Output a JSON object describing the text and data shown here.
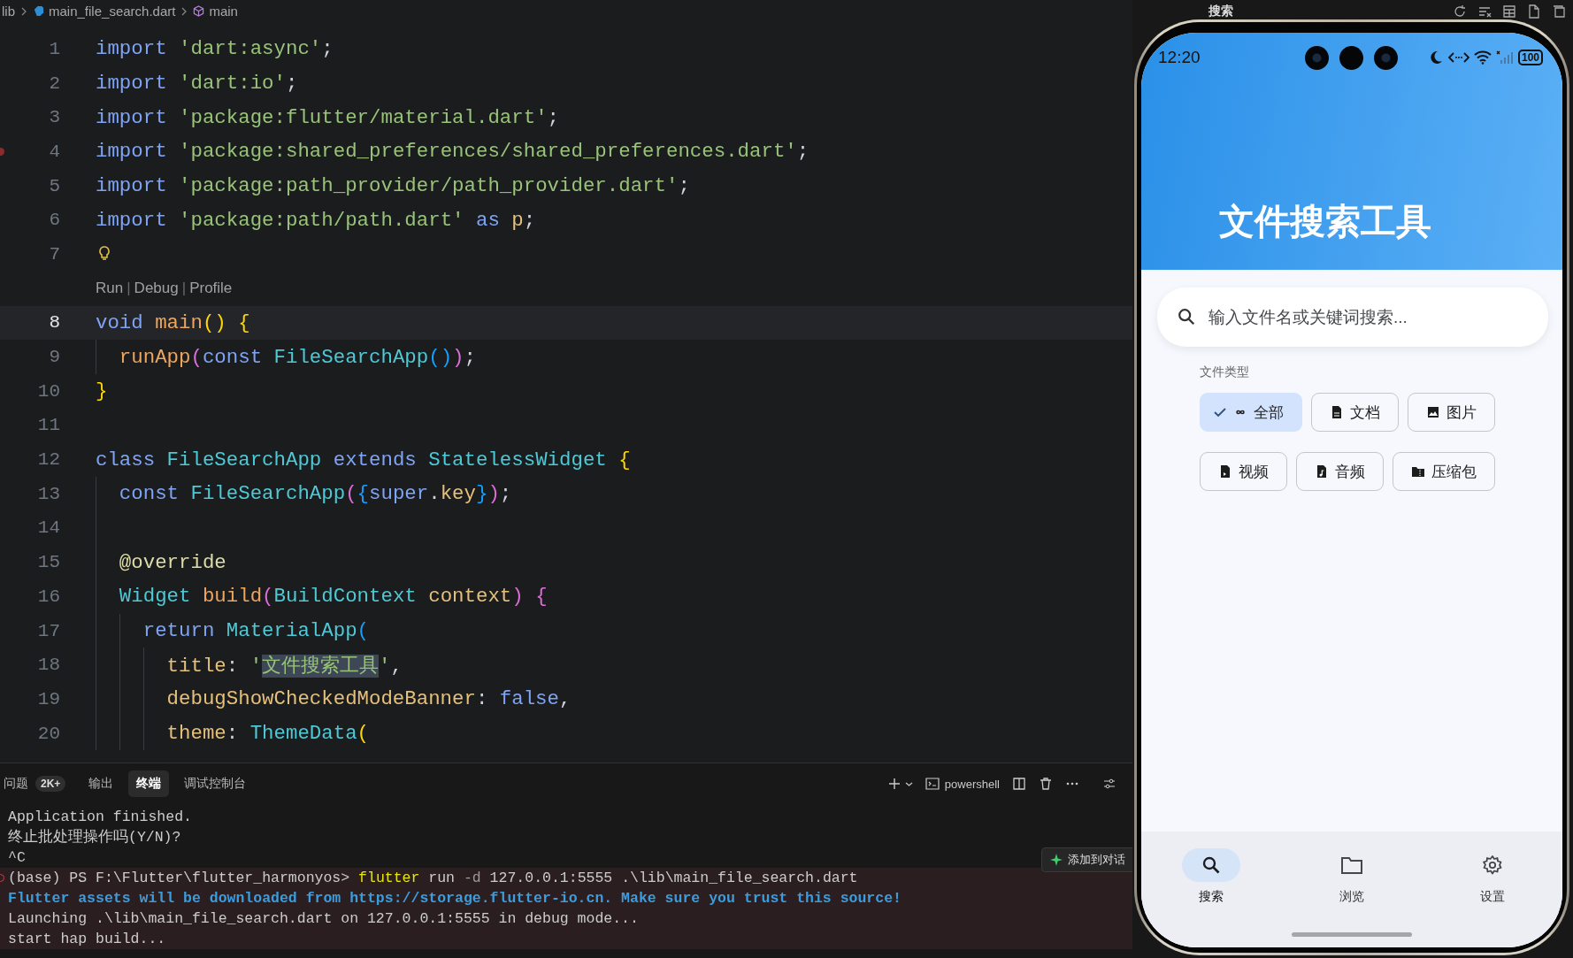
{
  "editor": {
    "breadcrumb": [
      {
        "kind": "folder",
        "text": "lib"
      },
      {
        "kind": "file",
        "text": "main_file_search.dart"
      },
      {
        "kind": "symbol",
        "text": "main"
      }
    ],
    "lines": [
      {
        "kind": "code",
        "number": "1",
        "current": false,
        "breakpoint": false,
        "lightbulb": false,
        "tokens": [
          {
            "kind": "kw",
            "text": "import"
          },
          {
            "kind": "str",
            "text": " 'dart:async'"
          },
          {
            "kind": "punct",
            "text": ";"
          }
        ]
      },
      {
        "kind": "code",
        "number": "2",
        "current": false,
        "breakpoint": false,
        "lightbulb": false,
        "tokens": [
          {
            "kind": "kw",
            "text": "import"
          },
          {
            "kind": "str",
            "text": " 'dart:io'"
          },
          {
            "kind": "punct",
            "text": ";"
          }
        ]
      },
      {
        "kind": "code",
        "number": "3",
        "current": false,
        "breakpoint": false,
        "lightbulb": false,
        "tokens": [
          {
            "kind": "kw",
            "text": "import"
          },
          {
            "kind": "str",
            "text": " 'package:flutter/material.dart'"
          },
          {
            "kind": "punct",
            "text": ";"
          }
        ]
      },
      {
        "kind": "code",
        "number": "4",
        "current": false,
        "breakpoint": true,
        "lightbulb": false,
        "tokens": [
          {
            "kind": "kw",
            "text": "import"
          },
          {
            "kind": "str",
            "text": " 'package:shared_preferences/shared_preferences.dart'"
          },
          {
            "kind": "punct",
            "text": ";"
          }
        ]
      },
      {
        "kind": "code",
        "number": "5",
        "current": false,
        "breakpoint": false,
        "lightbulb": false,
        "tokens": [
          {
            "kind": "kw",
            "text": "import"
          },
          {
            "kind": "str",
            "text": " 'package:path_provider/path_provider.dart'"
          },
          {
            "kind": "punct",
            "text": ";"
          }
        ]
      },
      {
        "kind": "code",
        "number": "6",
        "current": false,
        "breakpoint": false,
        "lightbulb": false,
        "tokens": [
          {
            "kind": "kw",
            "text": "import"
          },
          {
            "kind": "str",
            "text": " 'package:path/path.dart'"
          },
          {
            "kind": "kw",
            "text": " as"
          },
          {
            "kind": "var",
            "text": " p"
          },
          {
            "kind": "punct",
            "text": ";"
          }
        ]
      },
      {
        "kind": "code",
        "number": "7",
        "current": false,
        "breakpoint": false,
        "lightbulb": true
      },
      {
        "kind": "codelens",
        "parts": [
          {
            "kind": "link",
            "text": "Run"
          },
          {
            "kind": "sep",
            "text": "|"
          },
          {
            "kind": "link",
            "text": "Debug"
          },
          {
            "kind": "sep",
            "text": "|"
          },
          {
            "kind": "link",
            "text": "Profile"
          }
        ]
      },
      {
        "kind": "code",
        "number": "8",
        "current": true,
        "breakpoint": false,
        "lightbulb": false,
        "tokens": [
          {
            "kind": "kw",
            "text": "void"
          },
          {
            "kind": "fn",
            "text": " main"
          },
          {
            "kind": "b1",
            "text": "()"
          },
          {
            "kind": "b1",
            "text": " {"
          }
        ],
        "children": [
          {
            "kind": "code",
            "number": "9",
            "current": false,
            "breakpoint": false,
            "lightbulb": false,
            "tokens": [
              {
                "kind": "fn",
                "text": "runApp"
              },
              {
                "kind": "b2",
                "text": "("
              },
              {
                "kind": "kw",
                "text": "const"
              },
              {
                "kind": "type",
                "text": " FileSearchApp"
              },
              {
                "kind": "b3",
                "text": "()"
              },
              {
                "kind": "b2",
                "text": ")"
              },
              {
                "kind": "punct",
                "text": ";"
              }
            ]
          }
        ]
      },
      {
        "kind": "code",
        "number": "10",
        "current": false,
        "breakpoint": false,
        "lightbulb": false,
        "tokens": [
          {
            "kind": "b1",
            "text": "}"
          }
        ]
      },
      {
        "kind": "code",
        "number": "11",
        "current": false,
        "breakpoint": false,
        "lightbulb": false
      },
      {
        "kind": "code",
        "number": "12",
        "current": false,
        "breakpoint": false,
        "lightbulb": false,
        "tokens": [
          {
            "kind": "kw",
            "text": "class"
          },
          {
            "kind": "type",
            "text": " FileSearchApp"
          },
          {
            "kind": "kw",
            "text": " extends"
          },
          {
            "kind": "type",
            "text": " StatelessWidget"
          },
          {
            "kind": "b1",
            "text": " {"
          }
        ],
        "children": [
          {
            "kind": "code",
            "number": "13",
            "current": false,
            "breakpoint": false,
            "lightbulb": false,
            "tokens": [
              {
                "kind": "kw",
                "text": "const"
              },
              {
                "kind": "type",
                "text": " FileSearchApp"
              },
              {
                "kind": "b2",
                "text": "("
              },
              {
                "kind": "b3",
                "text": "{"
              },
              {
                "kind": "kw",
                "text": "super"
              },
              {
                "kind": "punct",
                "text": "."
              },
              {
                "kind": "var",
                "text": "key"
              },
              {
                "kind": "b3",
                "text": "}"
              },
              {
                "kind": "b2",
                "text": ")"
              },
              {
                "kind": "punct",
                "text": ";"
              }
            ]
          },
          {
            "kind": "code",
            "number": "14",
            "current": false,
            "breakpoint": false,
            "lightbulb": false
          },
          {
            "kind": "code",
            "number": "15",
            "current": false,
            "breakpoint": false,
            "lightbulb": false,
            "tokens": [
              {
                "kind": "ann",
                "text": "@override"
              }
            ]
          },
          {
            "kind": "code",
            "number": "16",
            "current": false,
            "breakpoint": false,
            "lightbulb": false,
            "tokens": [
              {
                "kind": "type",
                "text": "Widget"
              },
              {
                "kind": "fn",
                "text": " build"
              },
              {
                "kind": "b2",
                "text": "("
              },
              {
                "kind": "type",
                "text": "BuildContext"
              },
              {
                "kind": "var",
                "text": " context"
              },
              {
                "kind": "b2",
                "text": ")"
              },
              {
                "kind": "b2",
                "text": " {"
              }
            ],
            "children": [
              {
                "kind": "code",
                "number": "17",
                "current": false,
                "breakpoint": false,
                "lightbulb": false,
                "tokens": [
                  {
                    "kind": "kw",
                    "text": "return"
                  },
                  {
                    "kind": "type",
                    "text": " MaterialApp"
                  },
                  {
                    "kind": "b3",
                    "text": "("
                  }
                ],
                "children": [
                  {
                    "kind": "code",
                    "number": "18",
                    "current": false,
                    "breakpoint": false,
                    "lightbulb": false,
                    "tokens": [
                      {
                        "kind": "var",
                        "text": "title"
                      },
                      {
                        "kind": "punct",
                        "text": ": "
                      },
                      {
                        "kind": "str",
                        "text": "'"
                      },
                      {
                        "kind": "str_sel",
                        "text": "文件搜索工具"
                      },
                      {
                        "kind": "str",
                        "text": "'"
                      },
                      {
                        "kind": "punct",
                        "text": ","
                      }
                    ]
                  },
                  {
                    "kind": "code",
                    "number": "19",
                    "current": false,
                    "breakpoint": false,
                    "lightbulb": false,
                    "tokens": [
                      {
                        "kind": "var",
                        "text": "debugShowCheckedModeBanner"
                      },
                      {
                        "kind": "punct",
                        "text": ": "
                      },
                      {
                        "kind": "kw",
                        "text": "false"
                      },
                      {
                        "kind": "punct",
                        "text": ","
                      }
                    ]
                  },
                  {
                    "kind": "code",
                    "number": "20",
                    "current": false,
                    "breakpoint": false,
                    "lightbulb": false,
                    "tokens": [
                      {
                        "kind": "var",
                        "text": "theme"
                      },
                      {
                        "kind": "punct",
                        "text": ": "
                      },
                      {
                        "kind": "type",
                        "text": "ThemeData"
                      },
                      {
                        "kind": "b1",
                        "text": "("
                      }
                    ]
                  }
                ]
              }
            ]
          }
        ]
      }
    ]
  },
  "panel": {
    "tabs": [
      {
        "label": "问题",
        "badge": "2K+",
        "selected": false
      },
      {
        "label": "输出",
        "selected": false
      },
      {
        "label": "终端",
        "selected": true
      },
      {
        "label": "调试控制台",
        "selected": false
      }
    ],
    "shell": "powershell",
    "terminal": [
      {
        "highlighted": false,
        "failed": false,
        "segments": [
          {
            "kind": "plain",
            "text": "Application finished."
          }
        ]
      },
      {
        "highlighted": false,
        "failed": false,
        "segments": [
          {
            "kind": "plain",
            "text": "终止批处理操作吗(Y/N)?"
          }
        ]
      },
      {
        "highlighted": false,
        "failed": false,
        "segments": [
          {
            "kind": "plain",
            "text": "^C"
          }
        ]
      },
      {
        "highlighted": true,
        "failed": true,
        "segments": [
          {
            "kind": "plain",
            "text": "(base) PS F:\\Flutter\\flutter_harmonyos> "
          },
          {
            "kind": "command",
            "text": "flutter"
          },
          {
            "kind": "plain",
            "text": " run "
          },
          {
            "kind": "flag",
            "text": "-d"
          },
          {
            "kind": "plain",
            "text": " 127.0.0.1:5555 .\\lib\\main_file_search.dart"
          }
        ]
      },
      {
        "highlighted": true,
        "failed": false,
        "segments": [
          {
            "kind": "info",
            "text": "Flutter assets will be downloaded from https://storage.flutter-io.cn. Make sure you trust this source!"
          }
        ]
      },
      {
        "highlighted": true,
        "failed": false,
        "segments": [
          {
            "kind": "plain",
            "text": "Launching .\\lib\\main_file_search.dart on 127.0.0.1:5555 in debug mode..."
          }
        ]
      },
      {
        "highlighted": true,
        "failed": false,
        "segments": [
          {
            "kind": "plain",
            "text": "start hap build..."
          }
        ]
      }
    ],
    "chat_button": "添加到对话"
  },
  "side_panel": {
    "title": "搜索"
  },
  "phone": {
    "status_bar": {
      "time": "12:20",
      "battery": "100"
    },
    "title": "文件搜索工具",
    "search": {
      "placeholder": "输入文件名或关键词搜索..."
    },
    "filter_label": "文件类型",
    "chips": [
      {
        "kind": "all",
        "label": "全部",
        "selected": true
      },
      {
        "kind": "document",
        "label": "文档",
        "selected": false
      },
      {
        "kind": "image",
        "label": "图片",
        "selected": false
      },
      {
        "kind": "video",
        "label": "视频",
        "selected": false
      },
      {
        "kind": "audio",
        "label": "音频",
        "selected": false
      },
      {
        "kind": "archive",
        "label": "压缩包",
        "selected": false
      }
    ],
    "nav": [
      {
        "kind": "search",
        "label": "搜索",
        "selected": true
      },
      {
        "kind": "folder",
        "label": "浏览",
        "selected": false
      },
      {
        "kind": "settings",
        "label": "设置",
        "selected": false
      }
    ]
  }
}
